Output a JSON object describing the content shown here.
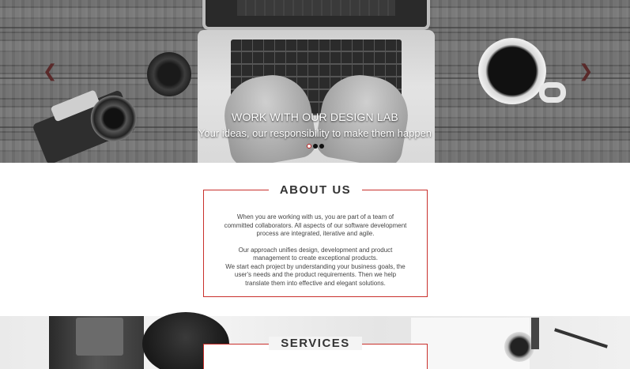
{
  "hero": {
    "title": "WORK WITH OUR DESIGN LAB",
    "subtitle": "Your ideas, our responsibility to make them happen",
    "prev_arrow": "❮",
    "next_arrow": "❯",
    "slide_count": 3,
    "active_slide": 1
  },
  "about": {
    "title": "ABOUT US",
    "paragraphs": [
      "When you are working with us, you are part of a team of committed collaborators. All aspects of our software development process are integrated, iterative and agile.",
      "Our approach unifies design, development and product management to create exceptional products.",
      "We start each project by understanding your business goals, the user's needs and the product requirements. Then we help translate them into effective and elegant solutions."
    ]
  },
  "services": {
    "title": "SERVICES"
  },
  "colors": {
    "accent": "#c9302c",
    "text": "#444444",
    "heading": "#333333"
  },
  "icons": {
    "prev": "chevron-left-icon",
    "next": "chevron-right-icon"
  }
}
